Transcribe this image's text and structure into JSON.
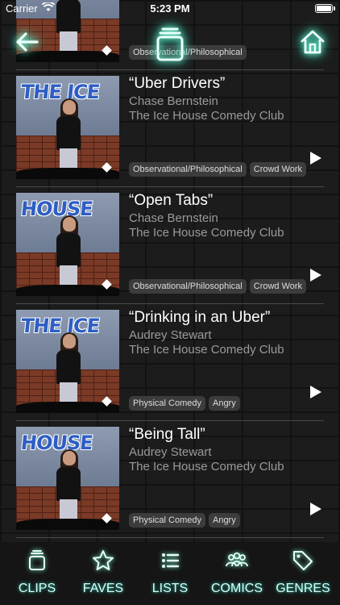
{
  "status_bar": {
    "carrier": "Carrier",
    "time": "5:23 PM"
  },
  "top_nav": {
    "back_icon": "arrow-left",
    "center_icon": "clips-stack",
    "home_icon": "house"
  },
  "clips": [
    {
      "title": "",
      "comic": "",
      "venue": "",
      "tags": [
        "Observational/Philosophical"
      ],
      "thumb_sign": ""
    },
    {
      "title": "“Uber Drivers”",
      "comic": "Chase Bernstein",
      "venue": "The Ice House Comedy Club",
      "tags": [
        "Observational/Philosophical",
        "Crowd Work"
      ],
      "thumb_sign": "THE ICE"
    },
    {
      "title": "“Open Tabs”",
      "comic": "Chase Bernstein",
      "venue": "The Ice House Comedy Club",
      "tags": [
        "Observational/Philosophical",
        "Crowd Work"
      ],
      "thumb_sign": "HOUSE"
    },
    {
      "title": "“Drinking in an Uber”",
      "comic": "Audrey Stewart",
      "venue": "The Ice House Comedy Club",
      "tags": [
        "Physical Comedy",
        "Angry"
      ],
      "thumb_sign": "THE ICE"
    },
    {
      "title": "“Being Tall”",
      "comic": "Audrey Stewart",
      "venue": "The Ice House Comedy Club",
      "tags": [
        "Physical Comedy",
        "Angry"
      ],
      "thumb_sign": "HOUSE"
    }
  ],
  "tab_bar": {
    "tabs": [
      {
        "label": "CLIPS",
        "icon": "clips-icon"
      },
      {
        "label": "FAVES",
        "icon": "star-icon"
      },
      {
        "label": "LISTS",
        "icon": "list-icon"
      },
      {
        "label": "COMICS",
        "icon": "people-icon"
      },
      {
        "label": "GENRES",
        "icon": "tag-icon"
      }
    ]
  },
  "colors": {
    "accent_glow": "#7fffd4",
    "background": "#1c1c1c"
  }
}
